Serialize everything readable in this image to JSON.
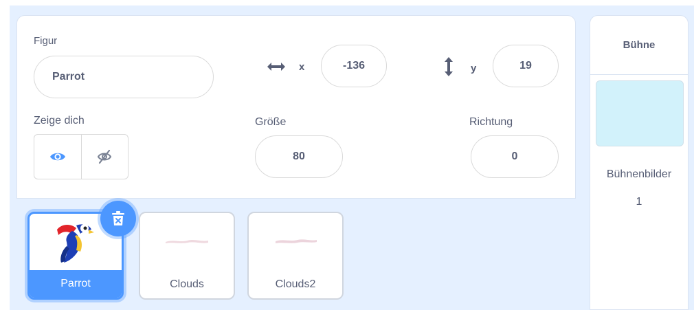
{
  "sprite_info": {
    "sprite_label": "Figur",
    "sprite_name": "Parrot",
    "x_label": "x",
    "x_value": "-136",
    "y_label": "y",
    "y_value": "19",
    "show_label": "Zeige dich",
    "size_label": "Größe",
    "size_value": "80",
    "direction_label": "Richtung",
    "direction_value": "0",
    "visibility_selected": "show"
  },
  "sprites": [
    {
      "name": "Parrot",
      "selected": true
    },
    {
      "name": "Clouds",
      "selected": false
    },
    {
      "name": "Clouds2",
      "selected": false
    }
  ],
  "stage": {
    "title": "Bühne",
    "backdrops_label": "Bühnenbilder",
    "backdrops_count": "1"
  },
  "colors": {
    "accent": "#4c97ff",
    "text": "#575e75",
    "backdrop": "#e5f0ff",
    "stage_thumb": "#d2f2fb"
  },
  "icons": {
    "x_axis": "horizontal-arrows-icon",
    "y_axis": "vertical-arrows-icon",
    "show": "eye-icon",
    "hide": "eye-hidden-icon",
    "delete": "trash-icon"
  }
}
